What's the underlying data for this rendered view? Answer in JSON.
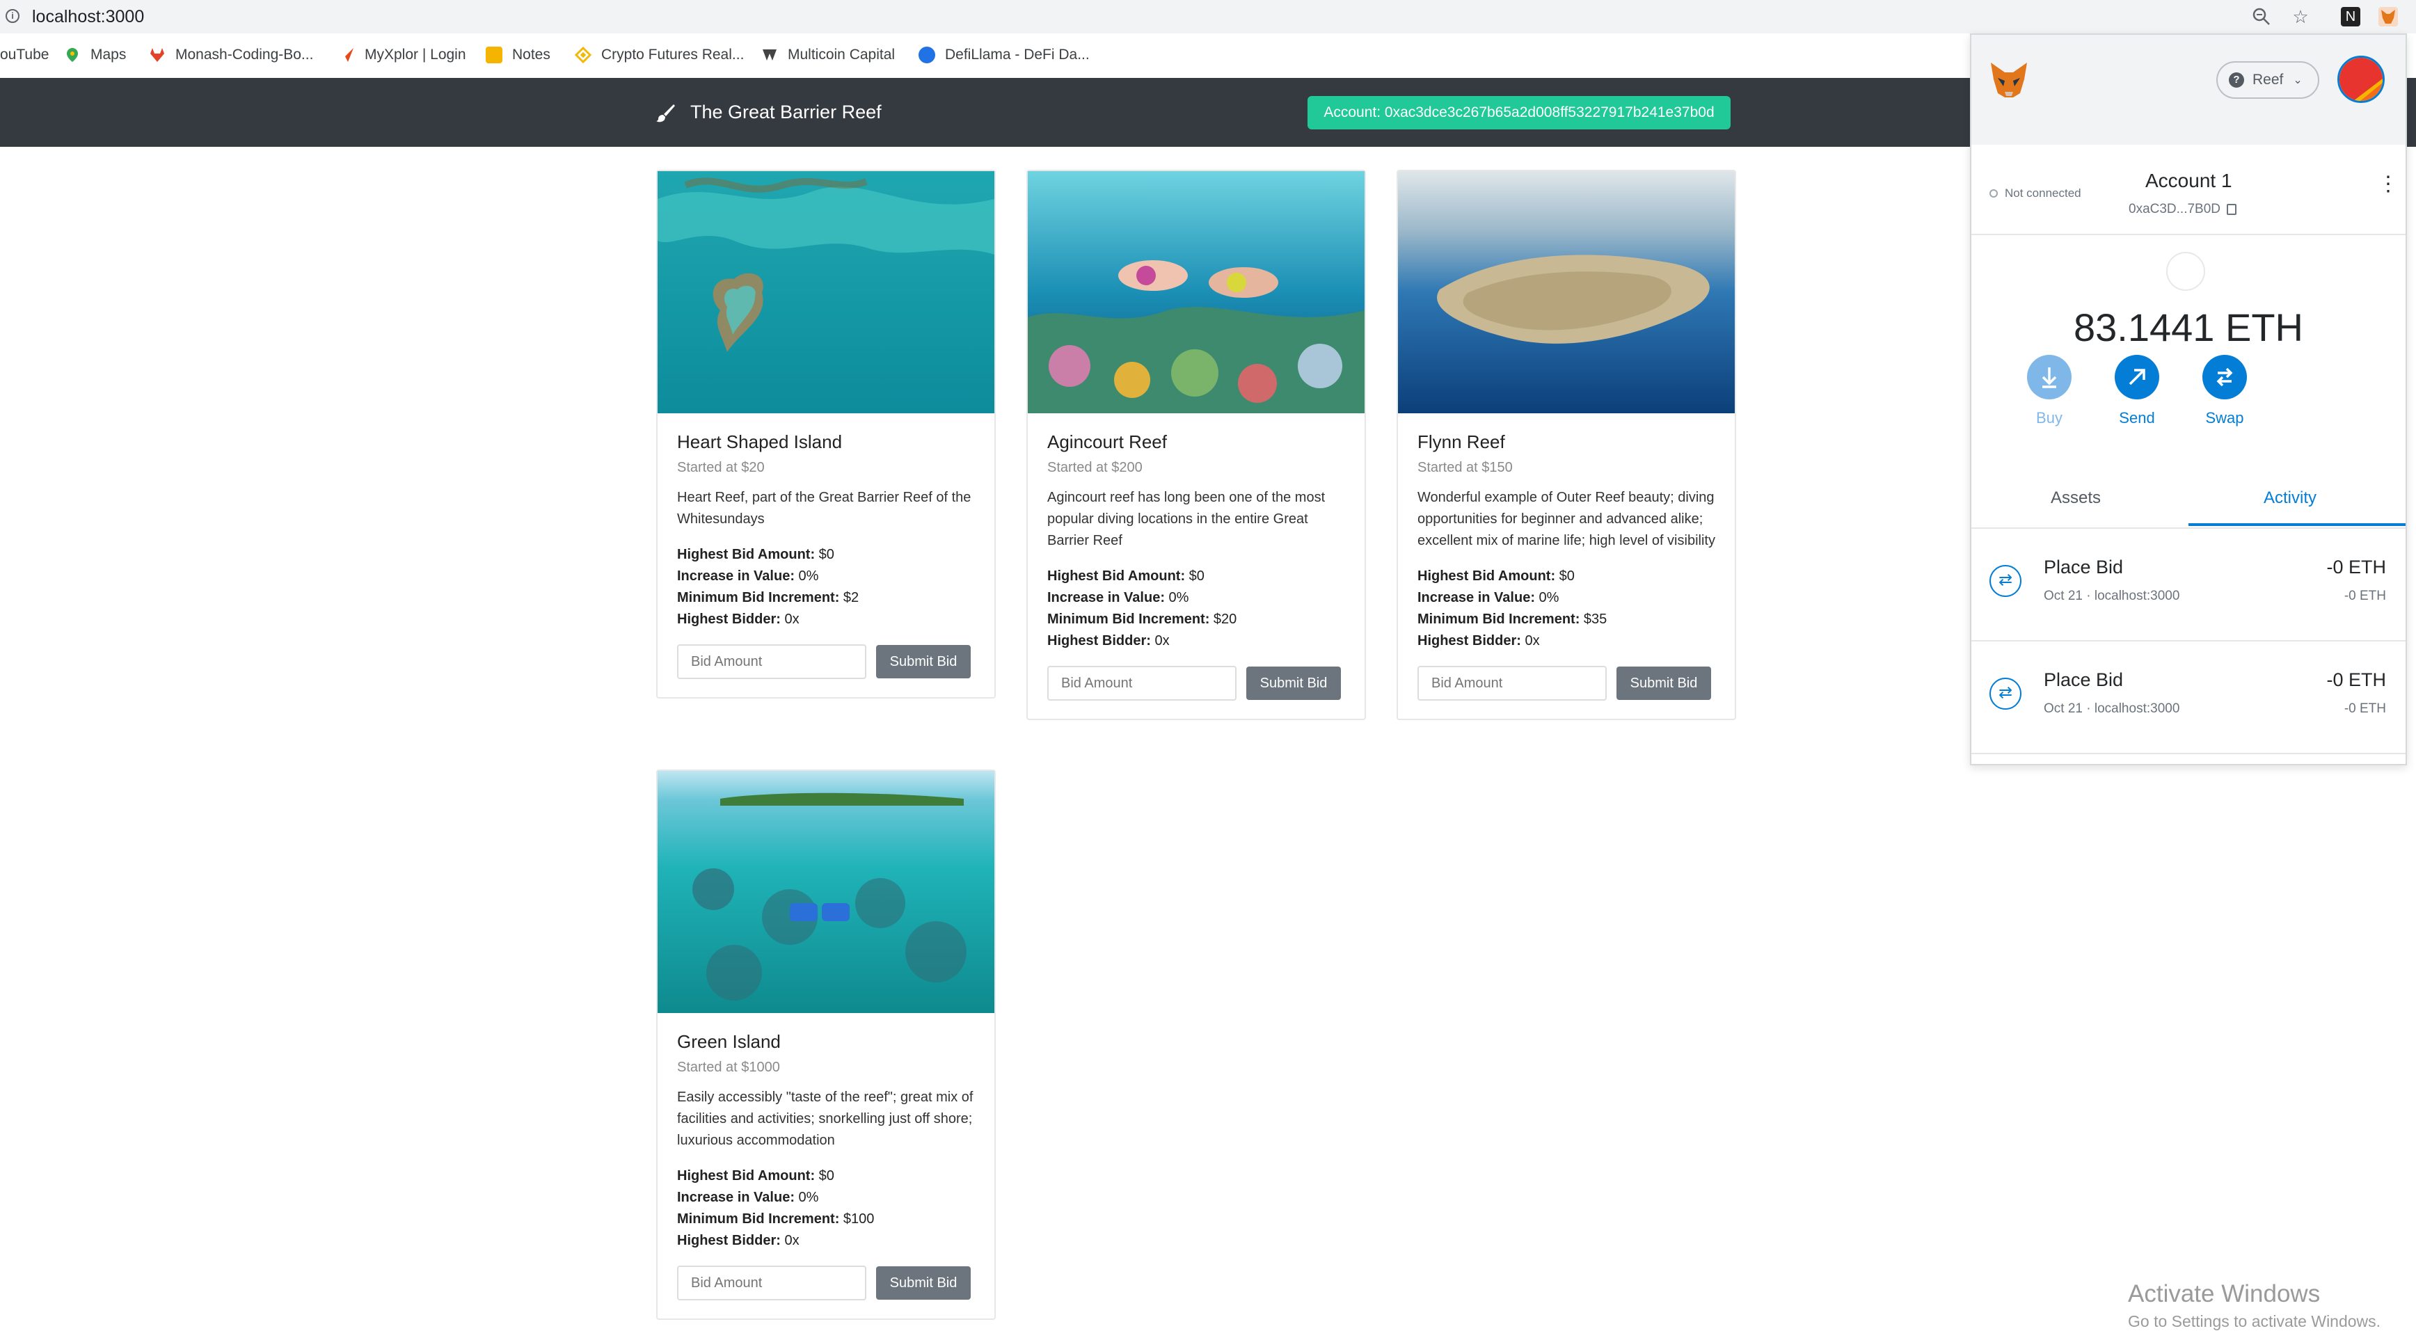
{
  "browser": {
    "url": "localhost:3000",
    "bookmarks": [
      {
        "label": "ouTube",
        "icon": "youtube-icon",
        "color": "#ffffff"
      },
      {
        "label": "Maps",
        "icon": "maps-icon",
        "color": "#34a853"
      },
      {
        "label": "Monash-Coding-Bo...",
        "icon": "gitlab-icon",
        "color": "#e24329"
      },
      {
        "label": "MyXplor | Login",
        "icon": "myxplor-icon",
        "color": "#e64a19"
      },
      {
        "label": "Notes",
        "icon": "notes-icon",
        "color": "#f5b400"
      },
      {
        "label": "Crypto Futures Real...",
        "icon": "binance-icon",
        "color": "#f0b90b"
      },
      {
        "label": "Multicoin Capital",
        "icon": "multicoin-icon",
        "color": "#444444"
      },
      {
        "label": "DefiLlama - DeFi Da...",
        "icon": "defillama-icon",
        "color": "#2172e5"
      }
    ]
  },
  "navbar": {
    "brand": "The Great Barrier Reef",
    "account": "Account: 0xac3dce3c267b65a2d008ff53227917b241e37b0d",
    "badge_color": "#20c997"
  },
  "cards": [
    {
      "title": "Heart Shaped Island",
      "started": "Started at $20",
      "description": "Heart Reef, part of the Great Barrier Reef of the Whitesundays",
      "highest_bid_label": "Highest Bid Amount:",
      "highest_bid": " $0",
      "increase_label": "Increase in Value:",
      "increase": " 0%",
      "min_inc_label": "Minimum Bid Increment:",
      "min_inc": " $2",
      "bidder_label": "Highest Bidder:",
      "bidder": " 0x",
      "placeholder": "Bid Amount",
      "button": "Submit Bid",
      "image": "heart-reef-aerial-photo"
    },
    {
      "title": "Agincourt Reef",
      "started": "Started at $200",
      "description": "Agincourt reef has long been one of the most popular diving locations in the entire Great Barrier Reef",
      "highest_bid_label": "Highest Bid Amount:",
      "highest_bid": " $0",
      "increase_label": "Increase in Value:",
      "increase": " 0%",
      "min_inc_label": "Minimum Bid Increment:",
      "min_inc": " $20",
      "bidder_label": "Highest Bidder:",
      "bidder": " 0x",
      "placeholder": "Bid Amount",
      "button": "Submit Bid",
      "image": "snorkelers-coral-photo"
    },
    {
      "title": "Flynn Reef",
      "started": "Started at $150",
      "description": "Wonderful example of Outer Reef beauty; diving opportunities for beginner and advanced alike; excellent mix of marine life; high level of visibility",
      "highest_bid_label": "Highest Bid Amount:",
      "highest_bid": " $0",
      "increase_label": "Increase in Value:",
      "increase": " 0%",
      "min_inc_label": "Minimum Bid Increment:",
      "min_inc": " $35",
      "bidder_label": "Highest Bidder:",
      "bidder": " 0x",
      "placeholder": "Bid Amount",
      "button": "Submit Bid",
      "image": "flynn-reef-aerial-photo"
    },
    {
      "title": "Green Island",
      "started": "Started at $1000",
      "description": "Easily accessibly \"taste of the reef\"; great mix of facilities and activities; snorkelling just off shore; luxurious accommodation",
      "highest_bid_label": "Highest Bid Amount:",
      "highest_bid": " $0",
      "increase_label": "Increase in Value:",
      "increase": " 0%",
      "min_inc_label": "Minimum Bid Increment:",
      "min_inc": " $100",
      "bidder_label": "Highest Bidder:",
      "bidder": " 0x",
      "placeholder": "Bid Amount",
      "button": "Submit Bid",
      "image": "green-island-photo"
    }
  ],
  "metamask": {
    "network": "Reef",
    "connection": "Not connected",
    "account_name": "Account 1",
    "account_addr": "0xaC3D...7B0D",
    "balance": "83.1441 ETH",
    "actions": [
      {
        "label": "Buy",
        "color": "#7fb8e8"
      },
      {
        "label": "Send",
        "color": "#037dd6"
      },
      {
        "label": "Swap",
        "color": "#037dd6"
      }
    ],
    "tabs": {
      "assets": "Assets",
      "activity": "Activity"
    },
    "accent": "#037dd6",
    "transactions": [
      {
        "title": "Place Bid",
        "sub": "Oct 21 · localhost:3000",
        "amount": "-0 ETH",
        "amount2": "-0 ETH"
      },
      {
        "title": "Place Bid",
        "sub": "Oct 21 · localhost:3000",
        "amount": "-0 ETH",
        "amount2": "-0 ETH"
      }
    ]
  },
  "watermark": {
    "line1": "Activate Windows",
    "line2": "Go to Settings to activate Windows."
  }
}
